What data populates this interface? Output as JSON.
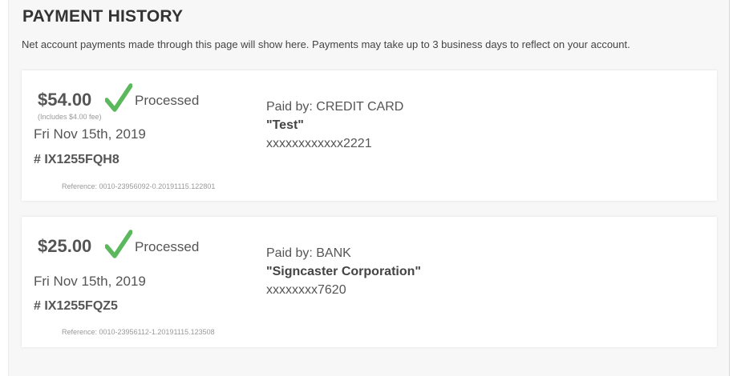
{
  "header": {
    "title": "PAYMENT HISTORY",
    "description": "Net account payments made through this page will show here. Payments may take up to 3 business days to reflect on your account."
  },
  "payments": [
    {
      "amount": "$54.00",
      "status": "Processed",
      "fee_note": "(Includes $4.00 fee)",
      "date": "Fri Nov 15th, 2019",
      "confirmation": "# IX1255FQH8",
      "reference": "Reference: 0010-23956092-0.20191115.122801",
      "paid_by": "Paid by: CREDIT CARD",
      "payer": "\"Test\"",
      "account": "xxxxxxxxxxxx2221"
    },
    {
      "amount": "$25.00",
      "status": "Processed",
      "fee_note": "",
      "date": "Fri Nov 15th, 2019",
      "confirmation": "# IX1255FQZ5",
      "reference": "Reference: 0010-23956112-1.20191115.123508",
      "paid_by": "Paid by: BANK",
      "payer": "\"Signcaster Corporation\"",
      "account": "xxxxxxxx7620"
    }
  ],
  "colors": {
    "check": "#5cb85c",
    "background": "#f7f7f7",
    "card": "#ffffff",
    "text": "#555555",
    "muted": "#999999"
  },
  "icons": {
    "status": "checkmark-icon"
  }
}
